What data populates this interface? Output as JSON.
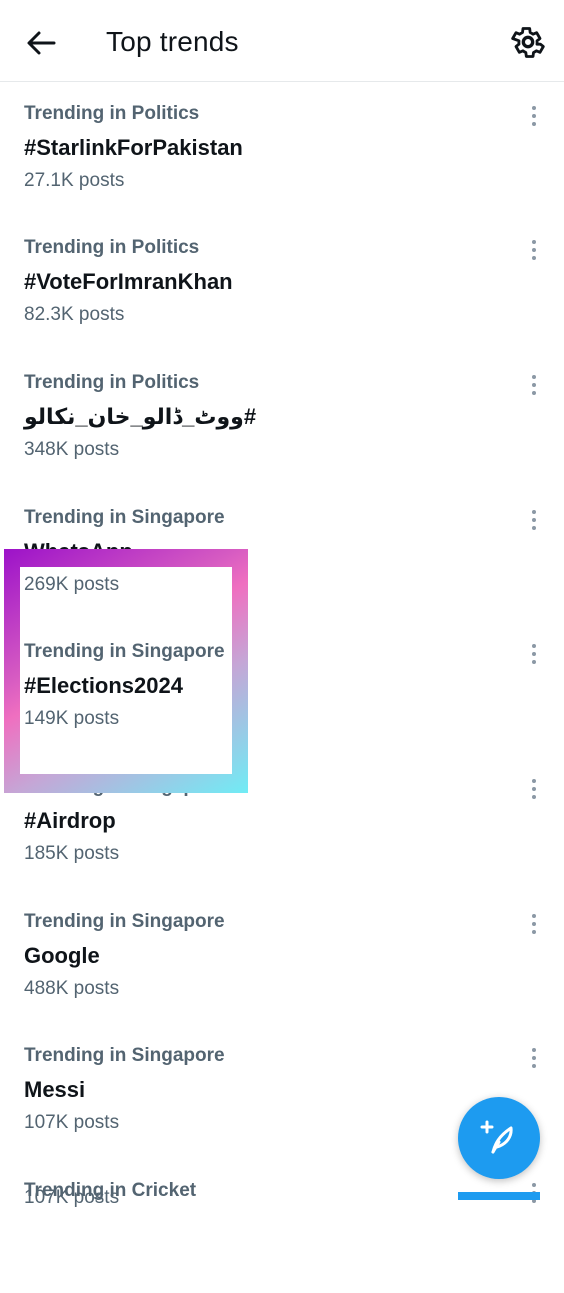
{
  "header": {
    "title": "Top trends",
    "back_icon": "arrow-left-icon",
    "settings_icon": "gear-icon"
  },
  "trends": [
    {
      "context": "Trending in Politics",
      "name": "#StarlinkForPakistan",
      "posts": "27.1K posts"
    },
    {
      "context": "Trending in Politics",
      "name": "#VoteForImranKhan",
      "posts": "82.3K posts"
    },
    {
      "context": "Trending in Politics",
      "name": "#ووٹ_ڈالو_خان_نکالو",
      "posts": "348K posts"
    },
    {
      "context": "Trending in Singapore",
      "name": "WhatsApp",
      "posts": "269K posts"
    },
    {
      "context": "Trending in Singapore",
      "name": "#Elections2024",
      "posts": "149K posts"
    },
    {
      "context": "Trending in Singapore",
      "name": "#Airdrop",
      "posts": "185K posts"
    },
    {
      "context": "Trending in Singapore",
      "name": "Google",
      "posts": "488K posts"
    },
    {
      "context": "Trending in Singapore",
      "name": "Messi",
      "posts": "107K posts"
    },
    {
      "context": "Trending in Cricket",
      "name": "",
      "posts": "107K posts"
    }
  ],
  "compose_button": {
    "icon": "compose-feather-plus-icon"
  },
  "colors": {
    "accent": "#1d9bf0",
    "secondary_text": "#536471",
    "primary_text": "#0f1419"
  }
}
